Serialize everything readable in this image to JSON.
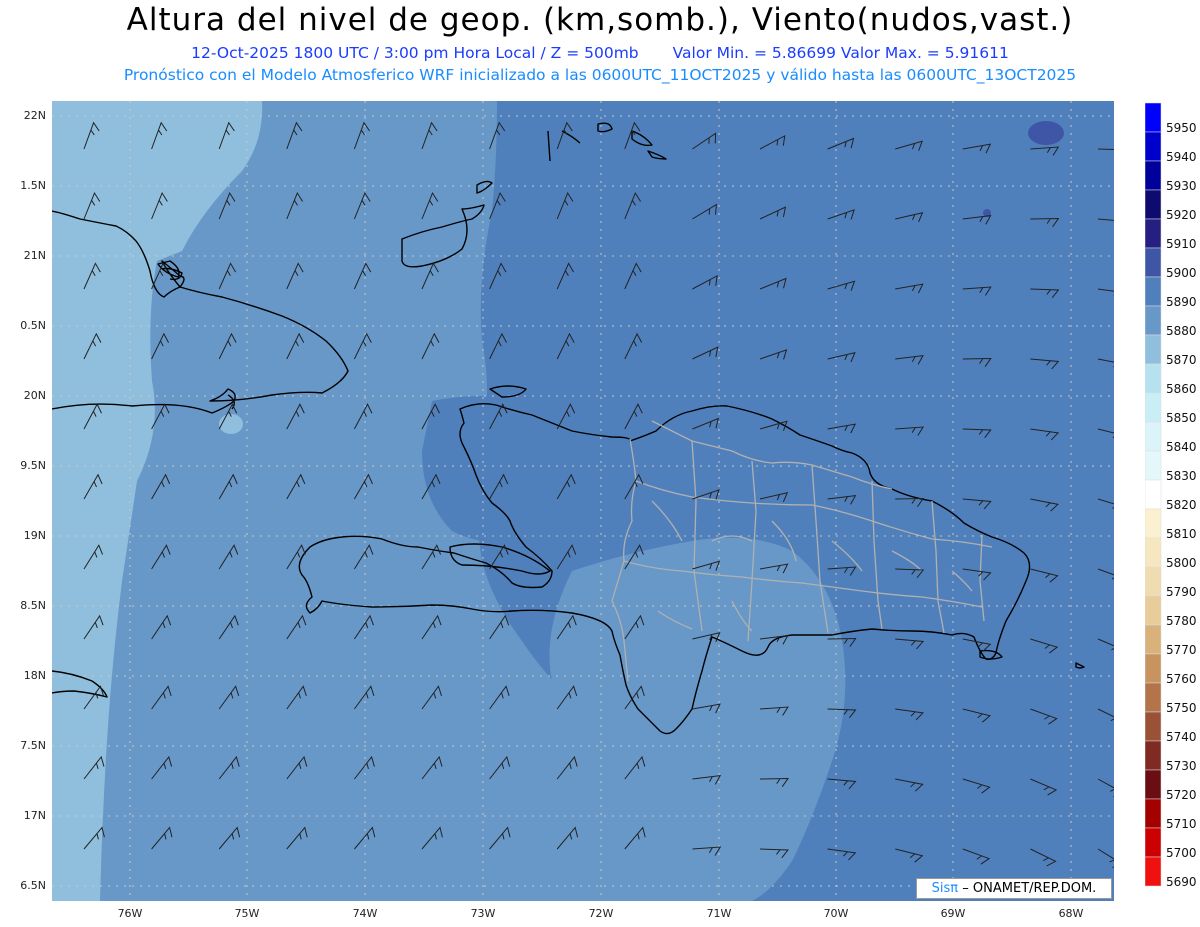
{
  "header": {
    "title": "Altura del nivel de geop. (km,somb.), Viento(nudos,vast.)",
    "date_line": "12-Oct-2025   1800 UTC / 3:00 pm Hora Local / Z = 500mb",
    "minmax_line": "Valor Min. = 5.86699   Valor Max. = 5.91611",
    "model_line": "Pronóstico con el Modelo Atmosferico WRF inicializado a las 0600UTC_11OCT2025 y válido hasta las  0600UTC_13OCT2025"
  },
  "axes": {
    "lat_labels": [
      "22N",
      "1.5N",
      "21N",
      "0.5N",
      "20N",
      "9.5N",
      "19N",
      "8.5N",
      "18N",
      "7.5N",
      "17N",
      "6.5N"
    ],
    "lon_labels": [
      "76W",
      "75W",
      "74W",
      "73W",
      "72W",
      "71W",
      "70W",
      "69W",
      "68W"
    ]
  },
  "colorbar": {
    "levels": [
      "5950",
      "5940",
      "5930",
      "5920",
      "5910",
      "5900",
      "5890",
      "5880",
      "5870",
      "5860",
      "5850",
      "5840",
      "5830",
      "5820",
      "5810",
      "5800",
      "5790",
      "5780",
      "5770",
      "5760",
      "5750",
      "5740",
      "5730",
      "5720",
      "5710",
      "5700",
      "5690"
    ],
    "colors": [
      "#0000ff",
      "#0000cd",
      "#00009a",
      "#0d0b6e",
      "#241f80",
      "#3f56a6",
      "#5080bc",
      "#6898c8",
      "#90bfdd",
      "#b6e2f0",
      "#c9eef6",
      "#daf4f9",
      "#e4f8fb",
      "#ffffff",
      "#fbf0cf",
      "#f6e7c0",
      "#efdcb0",
      "#e8cc9a",
      "#d9b17a",
      "#c7935f",
      "#b3744a",
      "#9a5236",
      "#7f2a22",
      "#6b0e14",
      "#a30000",
      "#cc0000",
      "#f01010"
    ]
  },
  "credit": {
    "sis": "Sisπ",
    "text": "– ONAMET/REP.DOM."
  },
  "colors": {
    "field_mid": "#5080bc",
    "field_light": "#6898c8",
    "field_lightest": "#90bfdd",
    "field_dark": "#3f56a6",
    "coast": "#000000",
    "provinces": "#b0b0b0"
  }
}
